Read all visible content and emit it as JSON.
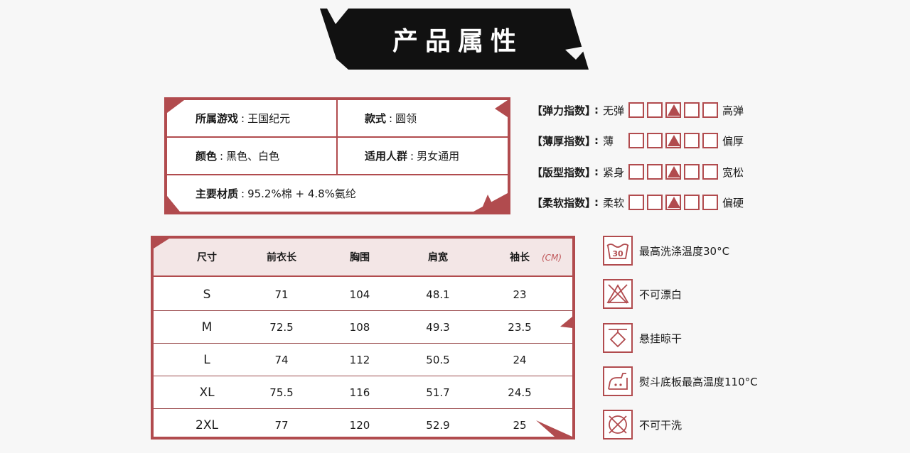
{
  "banner": {
    "title": "产品属性"
  },
  "attributes": {
    "game": {
      "key": "所属游戏",
      "value": "王国纪元"
    },
    "style": {
      "key": "款式",
      "value": "圆领"
    },
    "color": {
      "key": "颜色",
      "value": "黑色、白色"
    },
    "audience": {
      "key": "适用人群",
      "value": "男女通用"
    },
    "material": {
      "key": "主要材质",
      "value": "95.2%棉 + 4.8%氨纶"
    }
  },
  "indices": [
    {
      "key": "【弹力指数】",
      "low": "无弹",
      "high": "高弹",
      "level": 3
    },
    {
      "key": "【薄厚指数】",
      "low": "薄",
      "high": "偏厚",
      "level": 3
    },
    {
      "key": "【版型指数】",
      "low": "紧身",
      "high": "宽松",
      "level": 3
    },
    {
      "key": "【柔软指数】",
      "low": "柔软",
      "high": "偏硬",
      "level": 3
    }
  ],
  "size_table": {
    "unit": "(CM)",
    "headers": [
      "尺寸",
      "前衣长",
      "胸围",
      "肩宽",
      "袖长"
    ],
    "rows": [
      [
        "S",
        "71",
        "104",
        "48.1",
        "23"
      ],
      [
        "M",
        "72.5",
        "108",
        "49.3",
        "23.5"
      ],
      [
        "L",
        "74",
        "112",
        "50.5",
        "24"
      ],
      [
        "XL",
        "75.5",
        "116",
        "51.7",
        "24.5"
      ],
      [
        "2XL",
        "77",
        "120",
        "52.9",
        "25"
      ]
    ]
  },
  "care": [
    {
      "icon": "wash-30-icon",
      "label": "最高洗涤温度30°C",
      "icon_text": "30"
    },
    {
      "icon": "no-bleach-icon",
      "label": "不可漂白"
    },
    {
      "icon": "hang-dry-icon",
      "label": "悬挂晾干"
    },
    {
      "icon": "iron-icon",
      "label": "熨斗底板最高温度110°C"
    },
    {
      "icon": "no-dry-clean-icon",
      "label": "不可干洗"
    }
  ],
  "colors": {
    "accent": "#b14b4e",
    "banner": "#111111",
    "header_bg": "#f3e6e6"
  }
}
